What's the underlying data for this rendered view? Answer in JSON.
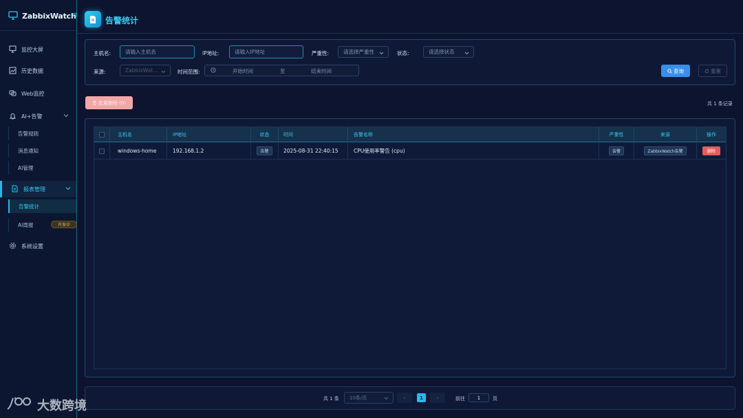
{
  "app": {
    "name": "ZabbixWatch",
    "menu_toggle": "≡"
  },
  "sidebar": {
    "items": [
      {
        "label": "监控大屏",
        "icon": "monitor-screen-icon"
      },
      {
        "label": "历史数据",
        "icon": "chart-icon"
      },
      {
        "label": "Web监控",
        "icon": "web-icon"
      },
      {
        "label": "AI+告警",
        "icon": "bell-icon"
      },
      {
        "label": "报表管理",
        "icon": "document-icon"
      },
      {
        "label": "系统设置",
        "icon": "gear-icon"
      }
    ],
    "alarm_sub": [
      "告警规则",
      "消息通知",
      "AI管理"
    ],
    "report_sub": [
      "告警统计",
      "AI周报"
    ],
    "dev_badge": "开发中"
  },
  "page": {
    "title": "告警统计"
  },
  "filters": {
    "hostname_label": "主机名:",
    "hostname_placeholder": "请输入主机名",
    "ip_label": "IP地址:",
    "ip_placeholder": "请输入IP地址",
    "severity_label": "严重性:",
    "severity_placeholder": "请选择严重性",
    "status_label": "状态:",
    "status_placeholder": "请选择状态",
    "source_label": "来源:",
    "source_value": "ZabbixWat...",
    "time_label": "时间范围:",
    "time_start": "开始时间",
    "time_to": "至",
    "time_end": "结束时间",
    "query_button": "查询",
    "reset_button": "重置"
  },
  "actions": {
    "batch_delete": "批量删除 (0)",
    "total_records": "共 1 条记录"
  },
  "table": {
    "headers": [
      "主机名",
      "IP地址",
      "状态",
      "时间",
      "告警名称",
      "严重性",
      "来源",
      "操作"
    ],
    "rows": [
      {
        "hostname": "windows-home",
        "ip": "192.168.1.2",
        "status": "告警",
        "time": "2025-08-31 22:40:15",
        "alert_name": "CPU使用率警告 (cpu)",
        "severity": "告警",
        "source": "ZabbixWatch告警",
        "action": "删除"
      }
    ]
  },
  "pagination": {
    "total": "共 1 条",
    "page_size": "10条/页",
    "prev": "‹",
    "current": "1",
    "next": "›",
    "goto_label": "前往",
    "goto_value": "1",
    "page_suffix": "页"
  },
  "watermark": "大数跨境",
  "colors": {
    "accent": "#2bb5e6",
    "primary_button": "#3a8fe8",
    "danger": "#e35d5d",
    "background": "#0d1430"
  }
}
